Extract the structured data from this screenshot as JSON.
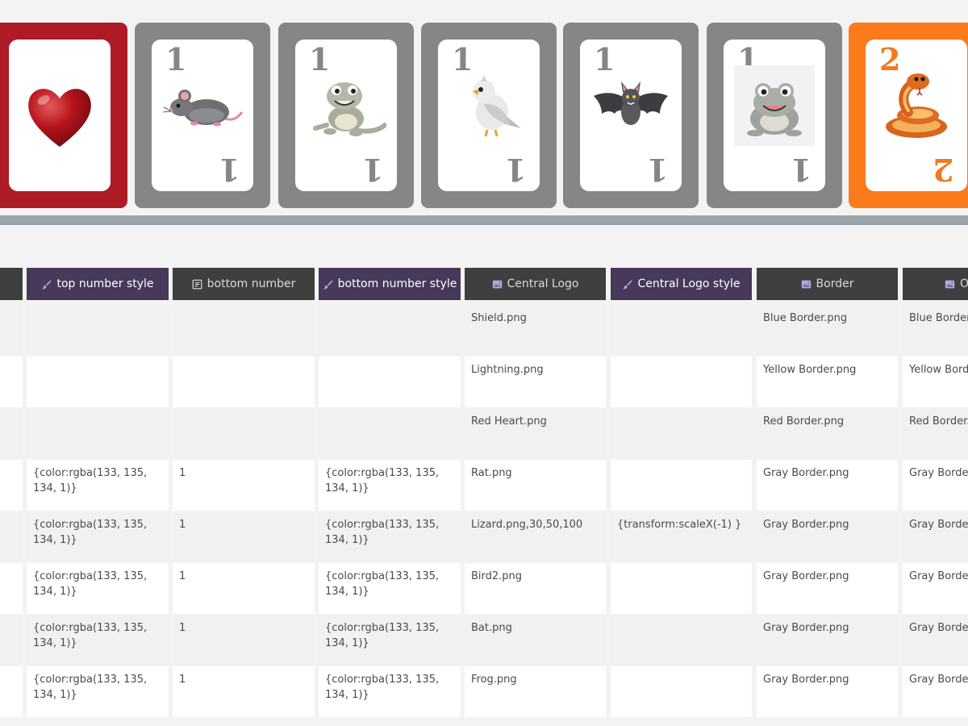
{
  "cards": [
    {
      "kind": "heart-card",
      "frame_color": "#ad1c26",
      "top_number": "",
      "bottom_number": "",
      "number_color": "",
      "art": "heart-icon"
    },
    {
      "kind": "animal-card",
      "frame_color": "#858786",
      "top_number": "1",
      "bottom_number": "1",
      "number_color": "#858786",
      "art": "rat-icon"
    },
    {
      "kind": "animal-card",
      "frame_color": "#858786",
      "top_number": "1",
      "bottom_number": "1",
      "number_color": "#858786",
      "art": "lizard-icon"
    },
    {
      "kind": "animal-card",
      "frame_color": "#858786",
      "top_number": "1",
      "bottom_number": "1",
      "number_color": "#858786",
      "art": "bird-icon"
    },
    {
      "kind": "animal-card",
      "frame_color": "#858786",
      "top_number": "1",
      "bottom_number": "1",
      "number_color": "#858786",
      "art": "bat-icon"
    },
    {
      "kind": "animal-card",
      "frame_color": "#858786",
      "top_number": "1",
      "bottom_number": "1",
      "number_color": "#858786",
      "art": "frog-icon"
    },
    {
      "kind": "animal-card",
      "frame_color": "#fb7a1c",
      "top_number": "2",
      "bottom_number": "2",
      "number_color": "#f07a1e",
      "art": "snake-icon"
    }
  ],
  "table": {
    "columns": [
      {
        "label": "",
        "type": "text",
        "style": "dark",
        "icon": ""
      },
      {
        "label": "top number style",
        "type": "style",
        "style": "purple",
        "icon": "brush-icon"
      },
      {
        "label": "bottom number",
        "type": "text",
        "style": "dark",
        "icon": "text-doc-icon"
      },
      {
        "label": "bottom number style",
        "type": "style",
        "style": "purple",
        "icon": "brush-icon"
      },
      {
        "label": "Central Logo",
        "type": "image",
        "style": "dark",
        "icon": "image-icon"
      },
      {
        "label": "Central Logo style",
        "type": "style",
        "style": "purple",
        "icon": "brush-icon"
      },
      {
        "label": "Border",
        "type": "image",
        "style": "dark",
        "icon": "image-icon"
      },
      {
        "label": "O",
        "type": "image",
        "style": "dark",
        "icon": "image-icon"
      }
    ],
    "rows": [
      [
        "",
        "",
        "",
        "",
        "Shield.png",
        "",
        "Blue Border.png",
        "Blue Border"
      ],
      [
        "",
        "",
        "",
        "",
        "Lightning.png",
        "",
        "Yellow Border.png",
        "Yellow Bord"
      ],
      [
        "",
        "",
        "",
        "",
        "Red Heart.png",
        "",
        "Red Border.png",
        "Red Border.p"
      ],
      [
        "",
        "{color:rgba(133, 135, 134, 1)}",
        "1",
        "{color:rgba(133, 135, 134, 1)}",
        "Rat.png",
        "",
        "Gray Border.png",
        "Gray Border"
      ],
      [
        "",
        "{color:rgba(133, 135, 134, 1)}",
        "1",
        "{color:rgba(133, 135, 134, 1)}",
        "Lizard.png,30,50,100",
        "{transform:scaleX(-1) }",
        "Gray Border.png",
        "Gray Border"
      ],
      [
        "",
        "{color:rgba(133, 135, 134, 1)}",
        "1",
        "{color:rgba(133, 135, 134, 1)}",
        "Bird2.png",
        "",
        "Gray Border.png",
        "Gray Border"
      ],
      [
        "",
        "{color:rgba(133, 135, 134, 1)}",
        "1",
        "{color:rgba(133, 135, 134, 1)}",
        "Bat.png",
        "",
        "Gray Border.png",
        "Gray Border"
      ],
      [
        "",
        "{color:rgba(133, 135, 134, 1)}",
        "1",
        "{color:rgba(133, 135, 134, 1)}",
        "Frog.png",
        "",
        "Gray Border.png",
        "Gray Border"
      ]
    ]
  },
  "colors": {
    "purple_header": "#463959",
    "dark_header": "#3f3f3f",
    "icon_accent": "#b9a3e6",
    "divider": "#9aa5aa"
  }
}
